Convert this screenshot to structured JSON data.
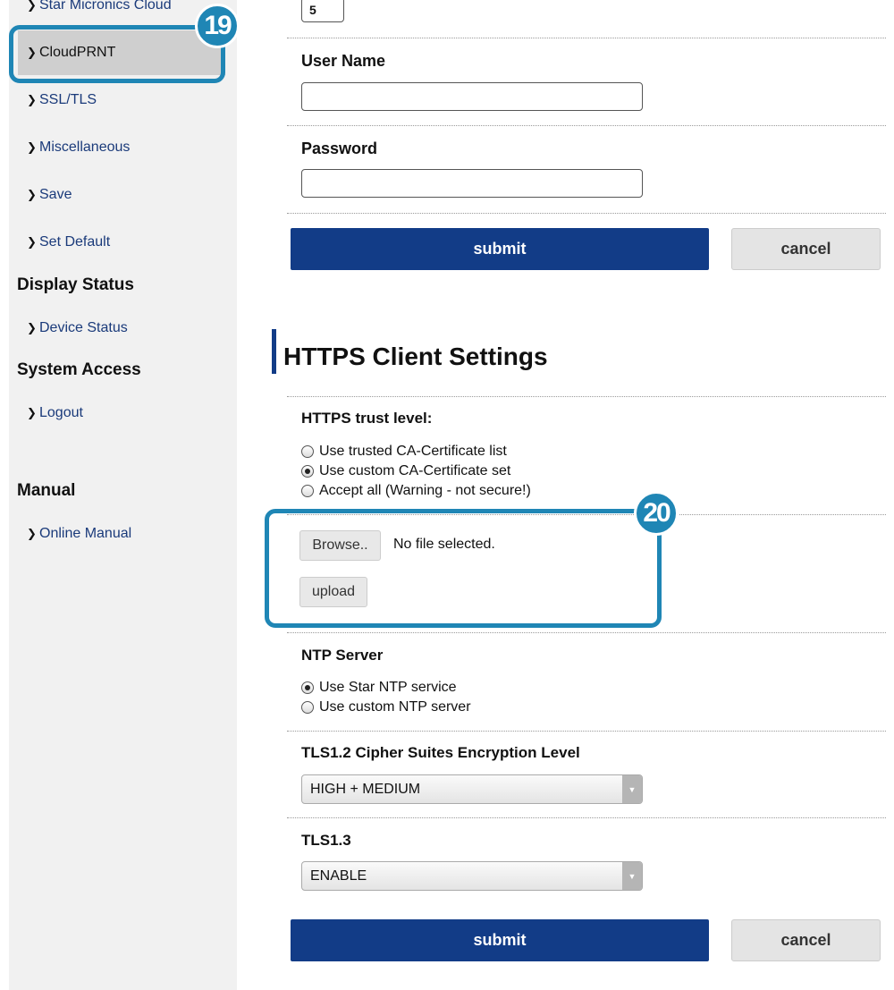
{
  "sidebar": {
    "items": [
      {
        "label": "Star Micronics Cloud"
      },
      {
        "label": "CloudPRNT"
      },
      {
        "label": "SSL/TLS"
      },
      {
        "label": "Miscellaneous"
      },
      {
        "label": "Save"
      },
      {
        "label": "Set Default"
      }
    ],
    "display_status": {
      "heading": "Display Status",
      "items": [
        {
          "label": "Device Status"
        }
      ]
    },
    "system_access": {
      "heading": "System Access",
      "items": [
        {
          "label": "Logout"
        }
      ]
    },
    "manual": {
      "heading": "Manual",
      "items": [
        {
          "label": "Online Manual"
        }
      ]
    }
  },
  "callouts": {
    "badge_19": "19",
    "badge_20": "20"
  },
  "auth_form": {
    "number_value": "5",
    "user_name_label": "User Name",
    "user_name_value": "",
    "password_label": "Password",
    "password_value": "",
    "submit_label": "submit",
    "cancel_label": "cancel"
  },
  "https_client": {
    "title": "HTTPS Client Settings",
    "trust_label": "HTTPS trust level:",
    "trust_options": [
      {
        "label": "Use trusted CA-Certificate list",
        "checked": false
      },
      {
        "label": "Use custom CA-Certificate set",
        "checked": true
      },
      {
        "label": "Accept all (Warning - not secure!)",
        "checked": false
      }
    ],
    "browse_label": "Browse..",
    "file_status": "No file selected.",
    "upload_label": "upload",
    "ntp_label": "NTP Server",
    "ntp_options": [
      {
        "label": "Use Star NTP service",
        "checked": true
      },
      {
        "label": "Use custom NTP server",
        "checked": false
      }
    ],
    "tls12_label": "TLS1.2 Cipher Suites Encryption Level",
    "tls12_value": "HIGH + MEDIUM",
    "tls13_label": "TLS1.3",
    "tls13_value": "ENABLE",
    "submit_label": "submit",
    "cancel_label": "cancel"
  },
  "colors": {
    "accent": "#123c87",
    "callout": "#1f86b5",
    "sidebar_bg": "#f1f1f1"
  }
}
